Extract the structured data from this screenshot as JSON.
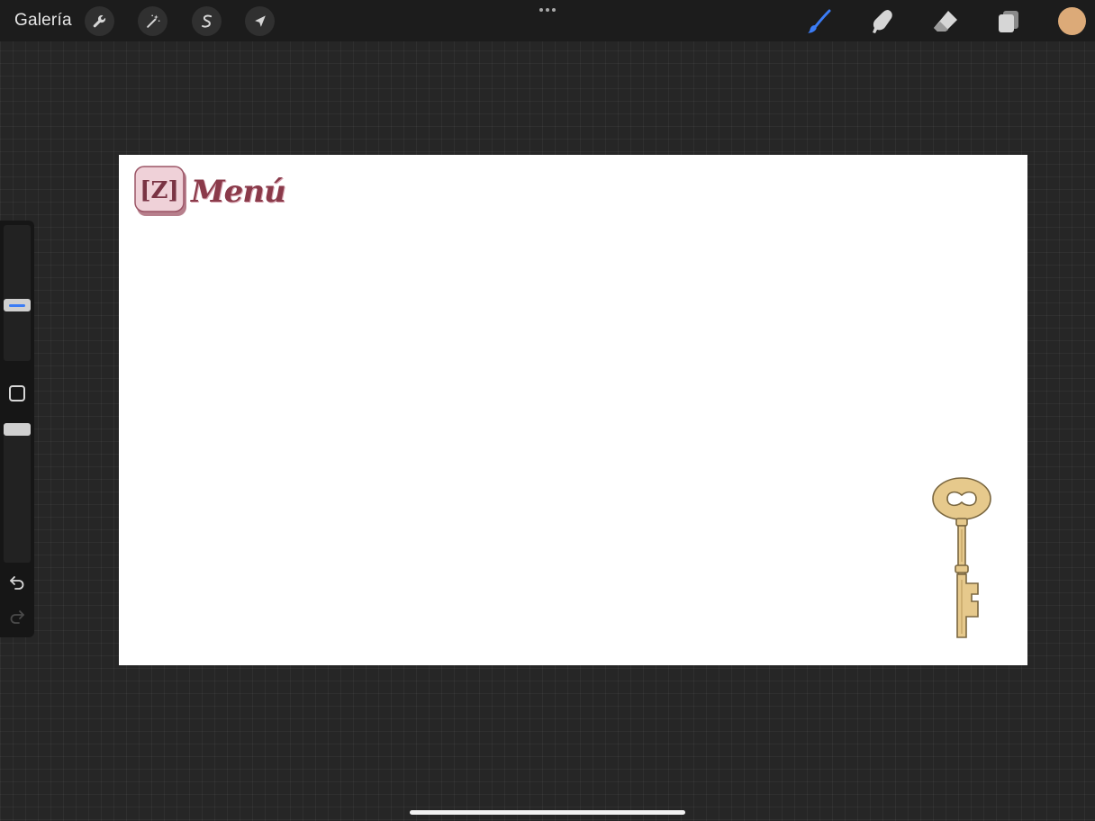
{
  "topbar": {
    "gallery_label": "Galería",
    "left_tools": [
      {
        "name": "actions",
        "icon": "wrench-icon"
      },
      {
        "name": "adjustments",
        "icon": "magic-wand-icon"
      },
      {
        "name": "selection",
        "icon": "selection-s-icon"
      },
      {
        "name": "transform",
        "icon": "arrow-cursor-icon"
      }
    ],
    "right_tools": [
      {
        "name": "brush",
        "icon": "brush-icon",
        "active": true
      },
      {
        "name": "smudge",
        "icon": "smudge-finger-icon",
        "active": false
      },
      {
        "name": "eraser",
        "icon": "eraser-icon",
        "active": false
      },
      {
        "name": "layers",
        "icon": "layers-icon",
        "active": false
      }
    ],
    "current_color": "#dcaa78",
    "accent_color": "#3b7cf5"
  },
  "sidebar": {
    "brush_size_level": 0.4,
    "opacity_level": 1.0,
    "undo_icon": "undo-icon",
    "redo_icon": "redo-icon",
    "modify_icon": "square-modify-icon"
  },
  "canvas": {
    "logo_glyph": "[Z]",
    "logo_text": "Menú",
    "logo_color": "#8a3a4a",
    "key_color": "#e6c98c"
  }
}
